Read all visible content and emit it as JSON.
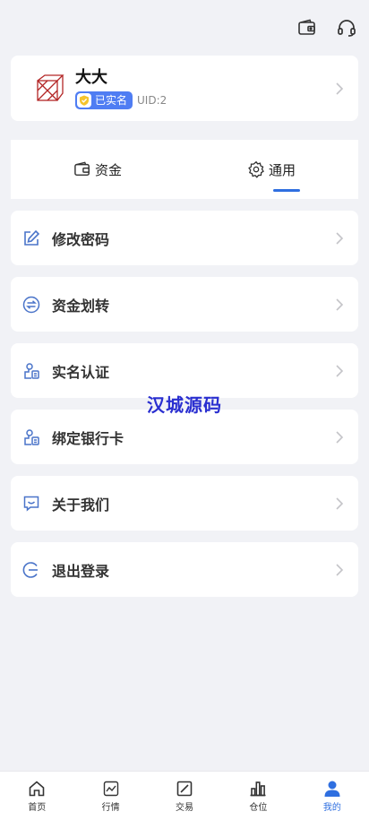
{
  "header": {
    "wallet_icon": "wallet-icon",
    "support_icon": "headset-icon"
  },
  "profile": {
    "name": "大大",
    "verified_badge": "已实名",
    "uid": "UID:2"
  },
  "tabs": [
    {
      "label": "资金",
      "icon": "wallet-icon",
      "active": false
    },
    {
      "label": "通用",
      "icon": "gear-icon",
      "active": true
    }
  ],
  "menu": [
    {
      "label": "修改密码",
      "icon": "edit-icon"
    },
    {
      "label": "资金划转",
      "icon": "transfer-icon"
    },
    {
      "label": "实名认证",
      "icon": "id-stamp-icon"
    },
    {
      "label": "绑定银行卡",
      "icon": "bank-card-icon"
    },
    {
      "label": "关于我们",
      "icon": "message-smile-icon"
    },
    {
      "label": "退出登录",
      "icon": "logout-icon"
    }
  ],
  "watermark": "汉城源码",
  "bottom_nav": [
    {
      "label": "首页",
      "icon": "home-icon"
    },
    {
      "label": "行情",
      "icon": "market-icon"
    },
    {
      "label": "交易",
      "icon": "trade-icon"
    },
    {
      "label": "仓位",
      "icon": "bar-chart-icon"
    },
    {
      "label": "我的",
      "icon": "user-icon",
      "active": true
    }
  ],
  "colors": {
    "accent": "#2f6fe0",
    "badge": "#4f7df3",
    "background": "#f1f2f6",
    "icon_blue": "#4a74c9",
    "watermark": "#2a2fd0"
  }
}
